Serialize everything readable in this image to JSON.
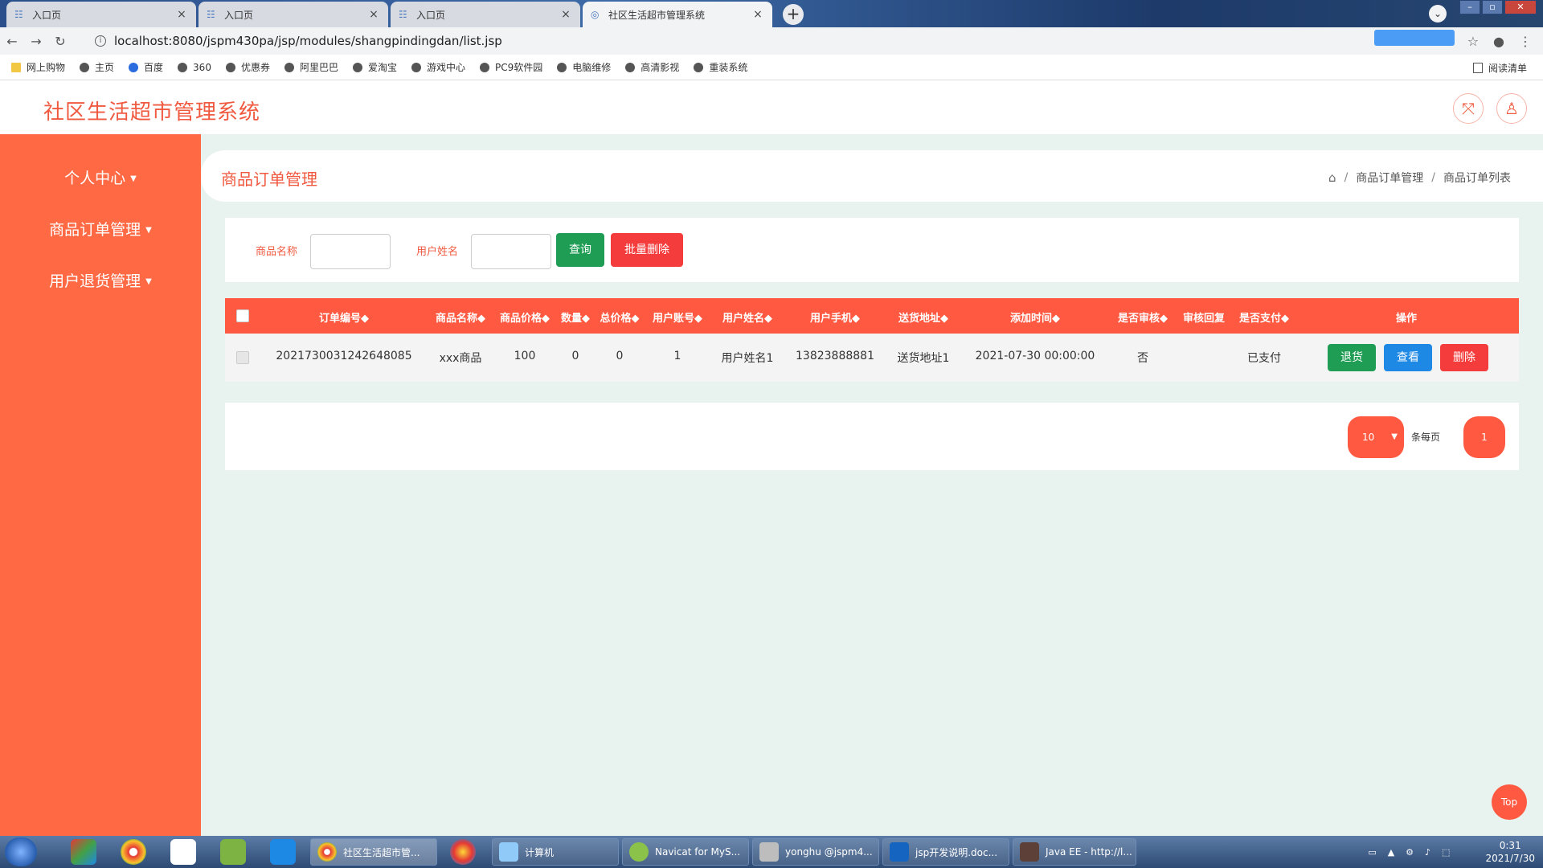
{
  "browser": {
    "tabs": [
      {
        "title": "入口页",
        "active": false
      },
      {
        "title": "入口页",
        "active": false
      },
      {
        "title": "入口页",
        "active": false
      },
      {
        "title": "社区生活超市管理系统",
        "active": true
      }
    ],
    "url": "localhost:8080/jspm430pa/jsp/modules/shangpindingdan/list.jsp",
    "bookmarks": [
      "网上购物",
      "主页",
      "百度",
      "360",
      "优惠券",
      "阿里巴巴",
      "爱淘宝",
      "游戏中心",
      "PC9软件园",
      "电脑维修",
      "高清影视",
      "重装系统"
    ],
    "reading_list": "阅读清单"
  },
  "app": {
    "title": "社区生活超市管理系统",
    "sidebar": [
      "个人中心",
      "商品订单管理",
      "用户退货管理"
    ],
    "page_title": "商品订单管理",
    "breadcrumb": [
      "商品订单管理",
      "商品订单列表"
    ],
    "search": {
      "product_label": "商品名称",
      "user_label": "用户姓名",
      "query_btn": "查询",
      "batch_delete_btn": "批量删除"
    },
    "table": {
      "headers": [
        "订单编号",
        "商品名称",
        "商品价格",
        "数量",
        "总价格",
        "用户账号",
        "用户姓名",
        "用户手机",
        "送货地址",
        "添加时间",
        "是否审核",
        "审核回复",
        "是否支付",
        "操作"
      ],
      "rows": [
        {
          "order_no": "2021730031242648085",
          "product": "xxx商品",
          "price": "100",
          "qty": "0",
          "total": "0",
          "account": "1",
          "user_name": "用户姓名1",
          "phone": "13823888881",
          "address": "送货地址1",
          "added": "2021-07-30 00:00:00",
          "audited": "否",
          "audit_reply": "",
          "paid": "已支付"
        }
      ],
      "actions": [
        "退货",
        "查看",
        "删除"
      ]
    },
    "pager": {
      "page_size": "10",
      "per_page_label": "条每页",
      "current_page": "1"
    },
    "top_btn": "Top"
  },
  "taskbar": {
    "tasks": [
      "社区生活超市管...",
      "计算机",
      "Navicat for MyS...",
      "yonghu @jspm4...",
      "jsp开发说明.doc...",
      "Java EE - http://l..."
    ],
    "time": "0:31",
    "date": "2021/7/30"
  },
  "colors": {
    "accent": "#ff5a41",
    "sidebar": "#ff6a45",
    "content_bg": "#e8f2ee",
    "green": "#1f9d55",
    "blue": "#1e88e5",
    "red": "#f53c3c"
  }
}
